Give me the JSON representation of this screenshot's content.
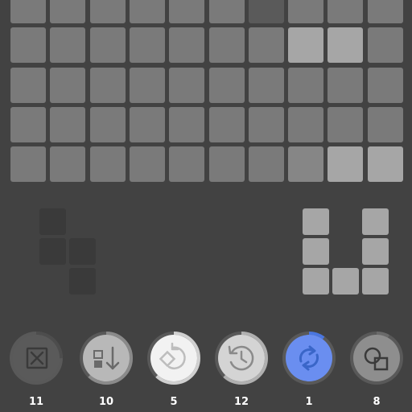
{
  "colors": {
    "background": "#424242",
    "cell_empty": "#7a7a7a",
    "cell_mid": "#868686",
    "cell_light": "#a6a6a6",
    "cell_dark": "#5a5a5a",
    "piece_dark": "#3a3a3a",
    "piece_light": "#a6a6a6",
    "button_ring": "#595959",
    "accent_blue": "#6a8ef0"
  },
  "board": {
    "columns": 10,
    "rows": 5,
    "cells": [
      [
        "empty",
        "empty",
        "empty",
        "empty",
        "empty",
        "empty",
        "dark",
        "empty",
        "empty",
        "empty"
      ],
      [
        "empty",
        "empty",
        "empty",
        "empty",
        "empty",
        "empty",
        "empty",
        "light",
        "light",
        "empty"
      ],
      [
        "empty",
        "empty",
        "empty",
        "empty",
        "empty",
        "empty",
        "empty",
        "empty",
        "empty",
        "empty"
      ],
      [
        "empty",
        "empty",
        "empty",
        "empty",
        "empty",
        "empty",
        "empty",
        "empty",
        "empty",
        "empty"
      ],
      [
        "empty",
        "empty",
        "empty",
        "empty",
        "empty",
        "empty",
        "empty",
        "mid",
        "light",
        "light"
      ]
    ]
  },
  "pieces": [
    {
      "name": "t-piece",
      "cells": [
        [
          0,
          0
        ],
        [
          1,
          0
        ],
        [
          1,
          1
        ],
        [
          2,
          1
        ]
      ],
      "state": "disabled"
    },
    {
      "name": "u-piece",
      "cells": [
        [
          0,
          0
        ],
        [
          0,
          2
        ],
        [
          1,
          0
        ],
        [
          1,
          2
        ],
        [
          2,
          0
        ],
        [
          2,
          1
        ],
        [
          2,
          2
        ]
      ],
      "state": "available"
    }
  ],
  "powerups": [
    {
      "name": "clear-button",
      "icon": "clear-x-icon",
      "count": "11",
      "progress": 0.25,
      "fill": "#5a5a5a",
      "icon_color": "#3a3a3a",
      "ring_color": "#4d4d4d"
    },
    {
      "name": "swap-down-button",
      "icon": "swap-down-icon",
      "count": "10",
      "progress": 0.62,
      "fill": "#b8b8b8",
      "icon_color": "#6a6a6a",
      "ring_color": "#8a8a8a"
    },
    {
      "name": "rotate-button",
      "icon": "rotate-piece-icon",
      "count": "5",
      "progress": 0.62,
      "fill": "#f2f2f2",
      "icon_color": "#bdbdbd",
      "ring_color": "#d0d0d0"
    },
    {
      "name": "undo-button",
      "icon": "history-icon",
      "count": "12",
      "progress": 0.62,
      "fill": "#d4d4d4",
      "icon_color": "#8a8a8a",
      "ring_color": "#b0b0b0"
    },
    {
      "name": "refresh-button",
      "icon": "refresh-icon",
      "count": "1",
      "progress": 0.1,
      "fill": "#6a8ef0",
      "icon_color": "#3a66c8",
      "ring_color": "#4a76e0"
    },
    {
      "name": "shapes-button",
      "icon": "shapes-icon",
      "count": "8",
      "progress": 0.08,
      "fill": "#8e8e8e",
      "icon_color": "#3a3a3a",
      "ring_color": "#6a6a6a"
    }
  ]
}
